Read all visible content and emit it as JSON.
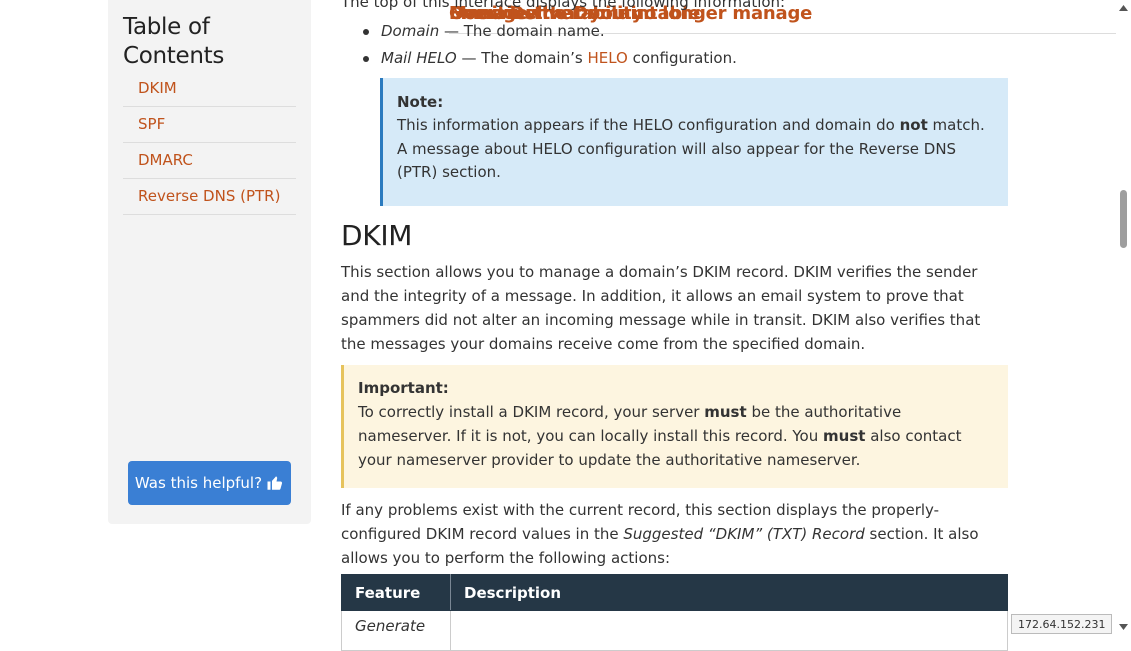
{
  "toc": {
    "title": "Table of Contents",
    "items": [
      {
        "label": "Overview",
        "level": "main"
      },
      {
        "label": "Email Deliverability table",
        "level": "main"
      },
      {
        "label": "Manage the Domain",
        "level": "main"
      },
      {
        "label": "DKIM",
        "level": "sub"
      },
      {
        "label": "SPF",
        "level": "sub"
      },
      {
        "label": "DMARC",
        "level": "sub"
      },
      {
        "label": "Reverse DNS (PTR)",
        "level": "sub"
      },
      {
        "label": "Domains that you no longer manage",
        "level": "main"
      }
    ],
    "helpful_button": "Was this helpful?",
    "helpful_icon": "thumbs-up-icon"
  },
  "content": {
    "intro": "The top of this interface displays the following information:",
    "bullets": [
      {
        "term": "Domain",
        "text": " — The domain name."
      },
      {
        "term": "Mail HELO",
        "text_before": " — The domain’s ",
        "link": "HELO",
        "text_after": " configuration."
      }
    ],
    "note": {
      "heading": "Note:",
      "text_before": "This information appears if the HELO configuration and domain do ",
      "bold": "not",
      "text_after": " match. A message about HELO configuration will also appear for the Reverse DNS (PTR) section."
    },
    "dkim_heading": "DKIM",
    "dkim_paragraph": "This section allows you to manage a domain’s DKIM record. DKIM verifies the sender and the integrity of a message. In addition, it allows an email system to prove that spammers did not alter an incoming message while in transit. DKIM also verifies that the messages your domains receive come from the specified domain.",
    "important": {
      "heading": "Important:",
      "part1": "To correctly install a DKIM record, your server ",
      "bold1": "must",
      "part2": " be the authoritative nameserver. If it is not, you can locally install this record. You ",
      "bold2": "must",
      "part3": " also contact your nameserver provider to update the authoritative nameserver."
    },
    "para2_before": "If any problems exist with the current record, this section displays the properly-configured DKIM record values in the ",
    "para2_italic": "Suggested “DKIM” (TXT) Record",
    "para2_after": " section. It also allows you to perform the following actions:",
    "table": {
      "headers": [
        "Feature",
        "Description"
      ],
      "rows": [
        [
          "Generate",
          ""
        ]
      ]
    }
  },
  "status": {
    "ip": "172.64.152.231"
  },
  "colors": {
    "link": "#c0531c",
    "button": "#3a7fd4",
    "note_bg": "#d6eaf8",
    "important_bg": "#fdf5e0",
    "table_header": "#253746"
  }
}
